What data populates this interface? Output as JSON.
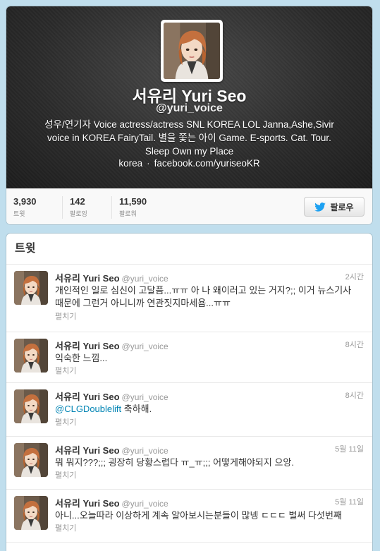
{
  "profile": {
    "name": "서유리 Yuri Seo",
    "handle": "@yuri_voice",
    "bio_lines": [
      "성우/연기자 Voice actress/actress SNL KOREA  LOL Janna,Ashe,Sivir",
      "voice in KOREA FairyTail. 별을 쫓는 아이 Game. E-sports. Cat. Tour.",
      "Sleep  Own my Place"
    ],
    "location": "korea",
    "separator": "·",
    "url": "facebook.com/yuriseoKR"
  },
  "stats": {
    "tweets": {
      "value": "3,930",
      "label": "트윗"
    },
    "following": {
      "value": "142",
      "label": "팔로잉"
    },
    "followers": {
      "value": "11,590",
      "label": "팔로워"
    }
  },
  "follow_button": {
    "label": "팔로우",
    "icon": "twitter-bird-icon"
  },
  "timeline": {
    "heading": "트윗",
    "expand_label": "펼치기",
    "tweets": [
      {
        "name": "서유리 Yuri Seo",
        "handle": "@yuri_voice",
        "time": "2시간",
        "lines": [
          "개인적인 일로 심신이 고달픔...ㅠㅠ 아 나 왜이러고 있는 거지?;; 이거 뉴스기사",
          "때문에 그런거 아니니까 연관짓지마세욤...ㅠㅠ"
        ]
      },
      {
        "name": "서유리 Yuri Seo",
        "handle": "@yuri_voice",
        "time": "8시간",
        "lines": [
          "익숙한 느낌..."
        ]
      },
      {
        "name": "서유리 Yuri Seo",
        "handle": "@yuri_voice",
        "time": "8시간",
        "mention": "@CLGDoublelift",
        "lines": [
          " 축하해."
        ]
      },
      {
        "name": "서유리 Yuri Seo",
        "handle": "@yuri_voice",
        "time": "5월 11일",
        "lines": [
          "뭐 뭐지???;;; 굉장히 당황스럽다 ㅠ_ㅠ;;; 어떻게해야되지 으앙."
        ]
      },
      {
        "name": "서유리 Yuri Seo",
        "handle": "@yuri_voice",
        "time": "5월 11일",
        "lines": [
          "아니...오늘따라 이상하게 계속 알아보시는분들이 많넹 ㄷㄷㄷ 벌써 다섯번째"
        ]
      }
    ]
  },
  "colors": {
    "background": "#c0deed",
    "link": "#0084b4",
    "header_dark": "#2b2b2b",
    "twitter_blue": "#1da1f2"
  }
}
